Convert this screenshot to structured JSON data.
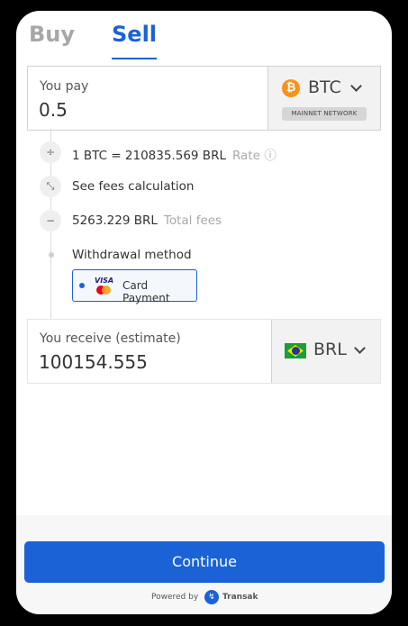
{
  "tabs": {
    "buy": "Buy",
    "sell": "Sell"
  },
  "pay": {
    "label": "You pay",
    "value": "0.5",
    "currency_code": "BTC",
    "coin_icon": "bitcoin-icon",
    "network": "MAINNET NETWORK"
  },
  "details": {
    "rate_value": "1 BTC = 210835.569 BRL",
    "rate_label": "Rate ⓘ",
    "fees_link": "See fees calculation",
    "total_fees_value": "5263.229 BRL",
    "total_fees_label": "Total fees",
    "withdrawal_label": "Withdrawal method",
    "payment_option": "Card Payment",
    "visa_text": "VISA"
  },
  "receive": {
    "label": "You receive (estimate)",
    "value": "100154.555",
    "currency_code": "BRL",
    "flag_icon": "brazil-flag-icon"
  },
  "footer": {
    "continue_label": "Continue",
    "powered_by": "Powered by",
    "brand": "Transak"
  },
  "colors": {
    "accent": "#1a62d6",
    "btc": "#f7931a"
  }
}
